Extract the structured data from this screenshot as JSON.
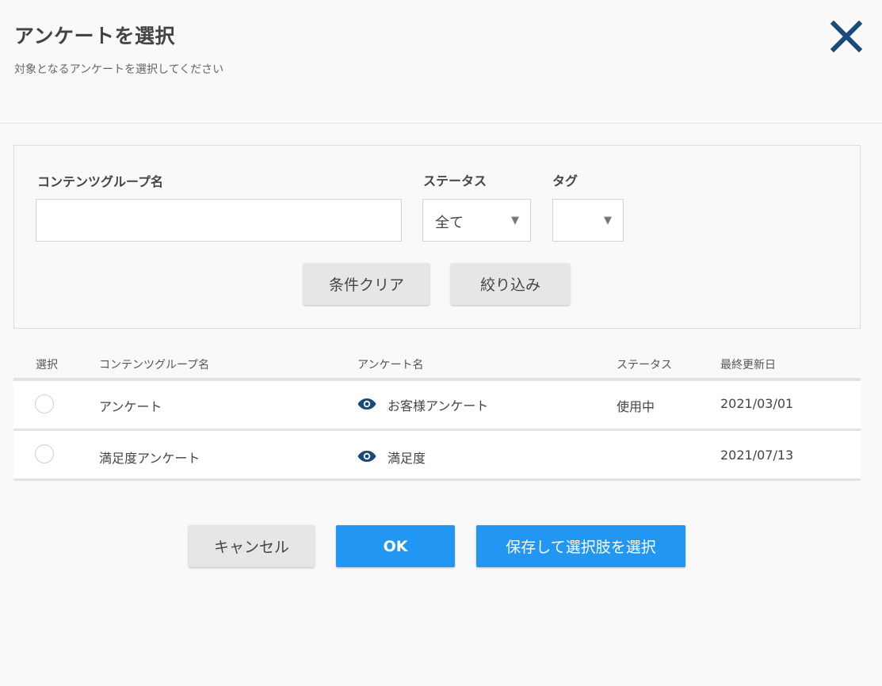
{
  "dialog": {
    "title": "アンケートを選択",
    "subtitle": "対象となるアンケートを選択してください",
    "close_icon": "close-icon"
  },
  "filters": {
    "group_name_label": "コンテンツグループ名",
    "group_name_value": "",
    "status_label": "ステータス",
    "status_value": "全て",
    "tag_label": "タグ",
    "tag_value": "",
    "clear_label": "条件クリア",
    "filter_label": "絞り込み"
  },
  "table": {
    "headers": [
      "選択",
      "コンテンツグループ名",
      "アンケート名",
      "ステータス",
      "最終更新日"
    ],
    "rows": [
      {
        "group": "アンケート",
        "survey": "お客様アンケート",
        "status": "使用中",
        "updated": "2021/03/01"
      },
      {
        "group": "満足度アンケート",
        "survey": "満足度",
        "status": "",
        "updated": "2021/07/13"
      }
    ]
  },
  "footer": {
    "cancel_label": "キャンセル",
    "ok_label": "OK",
    "save_label": "保存して選択肢を選択"
  },
  "colors": {
    "accent": "#2196f3",
    "icon_blue": "#1a4a7a"
  }
}
